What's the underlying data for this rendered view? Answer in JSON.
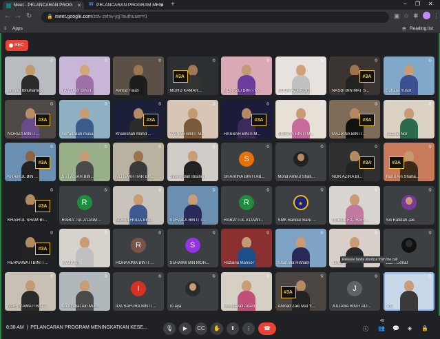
{
  "browser": {
    "tabs": [
      {
        "title": "Meet - PELANCARAN PROG",
        "favicon_color": "#00897b",
        "active": true
      },
      {
        "title": "PELANCARAN PROGRAM MENI",
        "favicon_color": "#4285f4",
        "favicon_letter": "W",
        "active": false
      }
    ],
    "new_tab": "+",
    "url_host": "meet.google.com",
    "url_path": "/zdv-zxhw-jqj?authuser=0",
    "bookmarks": [
      {
        "label": "Apps"
      },
      {
        "label": "Reading list"
      }
    ]
  },
  "meet": {
    "rec_label": "REC",
    "tiles": [
      {
        "name": "Ahmad Ibnuhamidy",
        "bg": "#b8bcc0",
        "type": "person",
        "skin": "#c19a6b",
        "cloth": "#2b2b2b"
      },
      {
        "name": "FARIDAH BINTI ...",
        "bg": "#c8b6d8",
        "type": "person",
        "skin": "#d2a77b",
        "cloth": "#9e6fa8"
      },
      {
        "name": "Ashraf Fauzi",
        "bg": "#5a5045",
        "type": "person",
        "skin": "#9c7550",
        "cloth": "#1d1d1d"
      },
      {
        "name": "MOHD KAMAR...",
        "bg": "#2d3033",
        "type": "sign",
        "skin": "#a07a55",
        "cloth": "#333"
      },
      {
        "name": "NORAZLI BINTI M...",
        "bg": "#d9a9b5",
        "type": "person",
        "skin": "#c49a72",
        "cloth": "#6a3c9c"
      },
      {
        "name": "NOOR AZMA BI...",
        "bg": "#e8e2df",
        "type": "person",
        "skin": "#cfa07a",
        "cloth": "#c0c0c0"
      },
      {
        "name": "NASBI BIN MAT S...",
        "bg": "#3a3530",
        "type": "sign",
        "skin": "#9c7550",
        "cloth": "#222"
      },
      {
        "name": "Suhaila Yusof",
        "bg": "#7fa8c9",
        "type": "person",
        "skin": "#c89b72",
        "cloth": "#3c4f90"
      },
      {
        "name": "NORIZA BINTI ...",
        "bg": "#4f4a45",
        "type": "sign",
        "skin": "#b88d66",
        "cloth": "#6a4b8a"
      },
      {
        "name": "norfadhilah musa",
        "bg": "#8fb0c2",
        "type": "person",
        "skin": "#c79d77",
        "cloth": "#3a5c8c"
      },
      {
        "name": "Khairishah Mohd ...",
        "bg": "#1b1f3a",
        "type": "sign",
        "skin": "#b48a62",
        "cloth": "#2b2b2b"
      },
      {
        "name": "ZARIAH BINTI M...",
        "bg": "#d7c6b5",
        "type": "person",
        "skin": "#c4996f",
        "cloth": "#7a5a3a"
      },
      {
        "name": "HASSAH BINTI M...",
        "bg": "#1a1c3a",
        "type": "sign",
        "skin": "#b48a62",
        "cloth": "#3a2b5a"
      },
      {
        "name": "SURAYA BINTI M...",
        "bg": "#e6e0d6",
        "type": "person",
        "skin": "#c99c76",
        "cloth": "#c76b9c"
      },
      {
        "name": "MAZIANA BINTI ...",
        "bg": "#7e6b58",
        "type": "sign",
        "skin": "#b48a62",
        "cloth": "#111"
      },
      {
        "name": "Nazzlid Nor",
        "bg": "#dcd2c4",
        "type": "person",
        "skin": "#c89b72",
        "cloth": "#2a6b4c"
      },
      {
        "name": "KHAIRUL BIN ...",
        "bg": "#6b8fb0",
        "type": "sign",
        "skin": "#8c6442",
        "cloth": "#222"
      },
      {
        "name": "SITI ASIAH BIN...",
        "bg": "#9ab08a",
        "type": "person",
        "skin": "#c79d77",
        "cloth": "#4a4a4a"
      },
      {
        "name": "MD BAKHTIAR BIN...",
        "bg": "#b9b2a0",
        "type": "person",
        "skin": "#9c7550",
        "cloth": "#3a3a3a"
      },
      {
        "name": "Syukriedah Ibrahim",
        "bg": "#d0ccc8",
        "type": "person",
        "skin": "#c99c76",
        "cloth": "#222"
      },
      {
        "name": "SHARIINA BINTI AB...",
        "bg": "#3c4043",
        "type": "avatar",
        "letter": "S",
        "avatar_color": "#e8710a"
      },
      {
        "name": "Mohd Amirul Shafi...",
        "bg": "#3c4043",
        "type": "avatar-photo",
        "skin": "#b48a62",
        "cloth": "#222"
      },
      {
        "name": "NOR AZIRA BI...",
        "bg": "#2f2f2f",
        "type": "sign",
        "skin": "#b48a62",
        "cloth": "#222"
      },
      {
        "name": "Nurul Ain Shaha...",
        "bg": "#c77b5a",
        "type": "sign",
        "skin": "#c4996f",
        "cloth": "#3a2b1a"
      },
      {
        "name": "KHAIRUL SHAM BI...",
        "bg": "#1f2124",
        "type": "sign",
        "skin": "#b48a62",
        "cloth": "#222"
      },
      {
        "name": "RABIA'TUL A'DAWI...",
        "bg": "#3c4043",
        "type": "avatar",
        "letter": "R",
        "avatar_color": "#1e8e3e"
      },
      {
        "name": "NORULHUDA BIN...",
        "bg": "#c9c4bb",
        "type": "person",
        "skin": "#c99c76",
        "cloth": "#3c5a90"
      },
      {
        "name": "SUHAILA BINTI T...",
        "bg": "#6b8fb0",
        "type": "person",
        "skin": "#c79d77",
        "cloth": "#2a2a5a"
      },
      {
        "name": "RABIA'TUL A'DAWI...",
        "bg": "#3c4043",
        "type": "avatar",
        "letter": "R",
        "avatar_color": "#1e8e3e"
      },
      {
        "name": "SMK Bandar Baru ...",
        "bg": "#3c4043",
        "type": "avatar-logo",
        "avatar_color": "#1a237e"
      },
      {
        "name": "NURUL FATIHAH ...",
        "bg": "#d8d4cf",
        "type": "person",
        "skin": "#c99c76",
        "cloth": "#c07aa0"
      },
      {
        "name": "Siti Rafidah Jas",
        "bg": "#3c4043",
        "type": "avatar-photo",
        "skin": "#c99c76",
        "cloth": "#7a3a9c"
      },
      {
        "name": "HERNAWATI BINTI ...",
        "bg": "#1f2124",
        "type": "sign",
        "skin": "#b48a62",
        "cloth": "#222"
      },
      {
        "name": "Awatif Arif",
        "bg": "#d6d2cc",
        "type": "person",
        "skin": "#c99c76",
        "cloth": "#c0c0c0"
      },
      {
        "name": "ROHAAIMA BINTI ...",
        "bg": "#3c4043",
        "type": "avatar",
        "letter": "R",
        "avatar_color": "#795548"
      },
      {
        "name": "SUHAIMI BIN MOH...",
        "bg": "#3c4043",
        "type": "avatar",
        "letter": "S",
        "avatar_color": "#9334e6"
      },
      {
        "name": "Rozaina Mansor",
        "bg": "#8a3030",
        "type": "person",
        "skin": "#c49a72",
        "cloth": "#1d4e89"
      },
      {
        "name": "Shahrina Hisham",
        "bg": "#7ea3c4",
        "type": "person",
        "skin": "#c99c76",
        "cloth": "#2a2a5a"
      },
      {
        "name": "hanyz...",
        "bg": "#d8d0c8",
        "type": "person",
        "skin": "#c99c76",
        "cloth": "#2b2b2b"
      },
      {
        "name": "zlaih nikmat",
        "bg": "#3c4043",
        "type": "avatar-photo",
        "skin": "#2b2b2b",
        "cloth": "#111"
      },
      {
        "name": "NORUZAWATI BINT...",
        "bg": "#c8c0b4",
        "type": "person",
        "skin": "#c49a72",
        "cloth": "#2a2a2a"
      },
      {
        "name": "Noorzabat Ain Mur...",
        "bg": "#b0b8bc",
        "type": "person",
        "skin": "#c79d77",
        "cloth": "#4a4a4a"
      },
      {
        "name": "IDA SAFURA BINTI ...",
        "bg": "#3c4043",
        "type": "avatar",
        "letter": "I",
        "avatar_color": "#d93025"
      },
      {
        "name": "ro aya",
        "bg": "#3c4043",
        "type": "avatar-photo",
        "skin": "#c79d77",
        "cloth": "#2b2b2b"
      },
      {
        "name": "Rosmayati Adam",
        "bg": "#d6cfc4",
        "type": "person",
        "skin": "#c99c76",
        "cloth": "#c0507a"
      },
      {
        "name": "Ahmad Zaki Mat Y...",
        "bg": "#4a4540",
        "type": "sign",
        "skin": "#b48a62",
        "cloth": "#222"
      },
      {
        "name": "JULIANA BINTI ALI...",
        "bg": "#3c4043",
        "type": "avatar",
        "letter": "J",
        "avatar_color": "#5f6368"
      },
      {
        "name": "You",
        "bg": "#c8d8e8",
        "type": "person",
        "skin": "#c99c76",
        "cloth": "#3a3a3a"
      }
    ],
    "tooltip": "Release tanda shortcut from the call",
    "meeting_time": "8:38 AM",
    "meeting_title": "PELANCARAN PROGRAM MENINGKATKAN KESE...",
    "participant_count": "49",
    "colors": {
      "recording": "#ea4335",
      "hangup": "#ea4335",
      "frame": "#1e8e3e",
      "background": "#202124",
      "speaking": "#8ab4f8"
    },
    "icons": [
      "mic-icon",
      "camera-icon",
      "captions-icon",
      "raise-hand-icon",
      "present-icon",
      "more-icon",
      "hangup-icon",
      "info-icon",
      "people-icon",
      "chat-icon",
      "activities-icon",
      "lock-icon"
    ]
  }
}
